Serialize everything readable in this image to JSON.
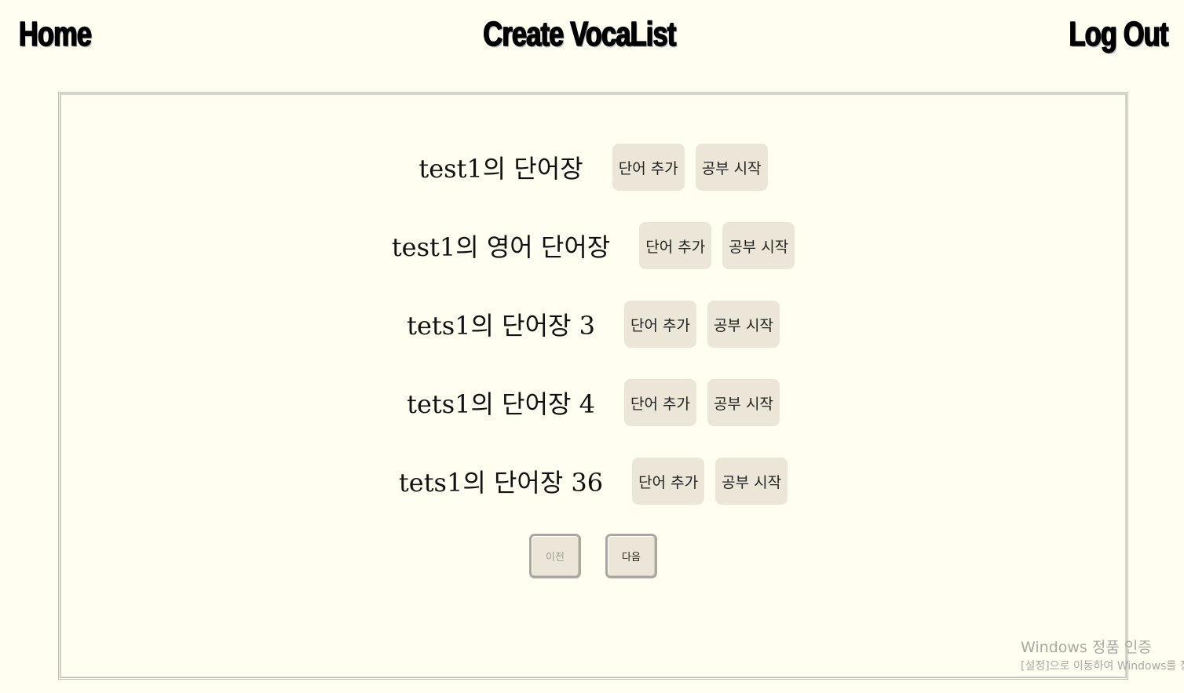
{
  "nav": {
    "home": "Home",
    "create": "Create VocaList",
    "logout": "Log Out"
  },
  "lists": [
    {
      "title": "test1의 단어장",
      "add_label": "단어 추가",
      "study_label": "공부 시작"
    },
    {
      "title": "test1의 영어 단어장",
      "add_label": "단어 추가",
      "study_label": "공부 시작"
    },
    {
      "title": "tets1의 단어장 3",
      "add_label": "단어 추가",
      "study_label": "공부 시작"
    },
    {
      "title": "tets1의 단어장 4",
      "add_label": "단어 추가",
      "study_label": "공부 시작"
    },
    {
      "title": "tets1의 단어장 36",
      "add_label": "단어 추가",
      "study_label": "공부 시작"
    }
  ],
  "pager": {
    "prev": "이전",
    "next": "다음"
  },
  "watermark": {
    "line1": "Windows 정품 인증",
    "line2": "[설정]으로 이동하여 Windows를 정품 인증합니다."
  }
}
